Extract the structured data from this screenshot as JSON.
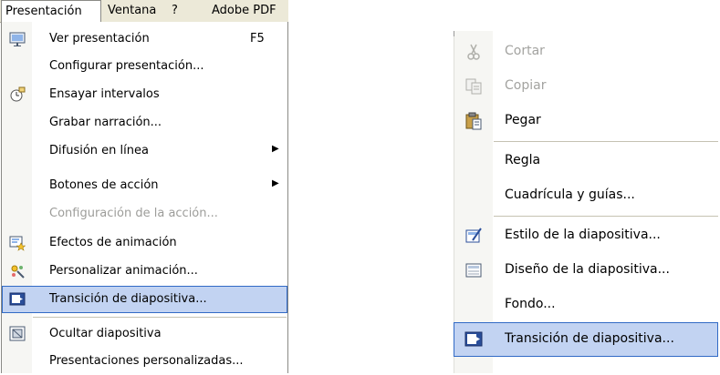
{
  "menubar": {
    "items": [
      "Presentación",
      "Ventana",
      "?",
      "Adobe PDF"
    ]
  },
  "left_menu": {
    "items": [
      {
        "label": "Ver presentación",
        "shortcut": "F5",
        "icon": "presentation-icon"
      },
      {
        "label": "Configurar presentación...",
        "icon": ""
      },
      {
        "label": "Ensayar intervalos",
        "icon": "timer-icon"
      },
      {
        "label": "Grabar narración...",
        "icon": ""
      },
      {
        "label": "Difusión en línea",
        "icon": "",
        "submenu": true
      },
      {
        "label": "Botones de acción",
        "icon": "",
        "submenu": true
      },
      {
        "label": "Configuración de la acción...",
        "icon": "",
        "disabled": true
      },
      {
        "label": "Efectos de animación",
        "icon": "animation-effects-icon"
      },
      {
        "label": "Personalizar animación...",
        "icon": "custom-animation-icon"
      },
      {
        "label": "Transición de diapositiva...",
        "icon": "slide-transition-icon",
        "highlighted": true
      },
      {
        "label": "Ocultar diapositiva",
        "icon": "hide-slide-icon"
      },
      {
        "label": "Presentaciones personalizadas...",
        "icon": ""
      }
    ]
  },
  "right_menu": {
    "items": [
      {
        "label": "Cortar",
        "icon": "scissors-icon",
        "disabled": true
      },
      {
        "label": "Copiar",
        "icon": "copy-icon",
        "disabled": true
      },
      {
        "label": "Pegar",
        "icon": "paste-icon"
      },
      {
        "label": "Regla",
        "icon": ""
      },
      {
        "label": "Cuadrícula y guías...",
        "icon": ""
      },
      {
        "label": "Estilo de la diapositiva...",
        "icon": "slide-style-icon"
      },
      {
        "label": "Diseño de la diapositiva...",
        "icon": "slide-layout-icon"
      },
      {
        "label": "Fondo...",
        "icon": ""
      },
      {
        "label": "Transición de diapositiva...",
        "icon": "slide-transition-icon",
        "highlighted": true
      }
    ]
  },
  "colors": {
    "highlight_bg": "#c2d3f2",
    "highlight_border": "#316ac5",
    "gutter": "#f6f6f3",
    "menubar_bg": "#ece9d8",
    "disabled_text": "#9d9d9a"
  }
}
